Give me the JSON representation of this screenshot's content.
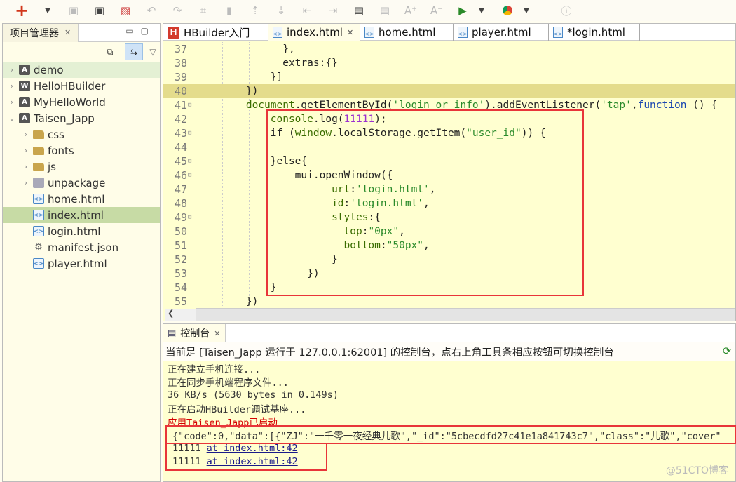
{
  "toolbar": {
    "icons": [
      "new-icon",
      "dropdown-icon",
      "save-icon",
      "save-all-icon",
      "close-file-icon",
      "undo-icon",
      "redo-icon",
      "format-icon",
      "bookmark-icon",
      "prev-edit-icon",
      "next-edit-icon",
      "indent-left-icon",
      "indent-right-icon",
      "comment-icon",
      "uncomment-icon",
      "font-increase-icon",
      "font-decrease-icon",
      "run-device-icon",
      "dropdown-icon",
      "chrome-icon",
      "dropdown-icon",
      "info-icon"
    ]
  },
  "sidebar": {
    "title": "项目管理器",
    "items": [
      {
        "label": "demo",
        "type": "proj",
        "mark": "A",
        "expanded": false,
        "depth": 0
      },
      {
        "label": "HelloHBuilder",
        "type": "proj",
        "mark": "W",
        "expanded": false,
        "depth": 0
      },
      {
        "label": "MyHelloWorld",
        "type": "proj",
        "mark": "A",
        "expanded": false,
        "depth": 0
      },
      {
        "label": "Taisen_Japp",
        "type": "proj",
        "mark": "A",
        "expanded": true,
        "depth": 0
      },
      {
        "label": "css",
        "type": "folder",
        "depth": 1
      },
      {
        "label": "fonts",
        "type": "folder",
        "depth": 1
      },
      {
        "label": "js",
        "type": "folder",
        "depth": 1
      },
      {
        "label": "unpackage",
        "type": "pkg",
        "depth": 1
      },
      {
        "label": "home.html",
        "type": "file",
        "depth": 1
      },
      {
        "label": "index.html",
        "type": "file",
        "depth": 1,
        "selected": true
      },
      {
        "label": "login.html",
        "type": "file",
        "depth": 1
      },
      {
        "label": "manifest.json",
        "type": "json",
        "depth": 1
      },
      {
        "label": "player.html",
        "type": "file",
        "depth": 1
      }
    ]
  },
  "editor": {
    "tabs": [
      {
        "label": "HBuilder入门",
        "icon": "hbuilder-icon"
      },
      {
        "label": "index.html",
        "icon": "html-file-icon",
        "active": true,
        "closable": true
      },
      {
        "label": "home.html",
        "icon": "html-file-icon"
      },
      {
        "label": "player.html",
        "icon": "html-file-icon"
      },
      {
        "label": "*login.html",
        "icon": "html-file-icon"
      }
    ],
    "lines": [
      {
        "n": "37",
        "t": [
          [
            "              },",
            "p"
          ]
        ]
      },
      {
        "n": "38",
        "t": [
          [
            "              extras:{}",
            "p"
          ]
        ]
      },
      {
        "n": "39",
        "t": [
          [
            "            }]",
            "p"
          ]
        ]
      },
      {
        "n": "40",
        "hl": true,
        "t": [
          [
            "        })",
            "p"
          ]
        ]
      },
      {
        "n": "41",
        "fold": true,
        "t": [
          [
            "        ",
            "p"
          ],
          [
            "document",
            "i"
          ],
          [
            ".getElementById(",
            "p"
          ],
          [
            "'login_or_info'",
            "s"
          ],
          [
            ").addEventListener(",
            "p"
          ],
          [
            "'tap'",
            "s"
          ],
          [
            ",",
            "p"
          ],
          [
            "function",
            "k"
          ],
          [
            " () {",
            "p"
          ]
        ]
      },
      {
        "n": "42",
        "t": [
          [
            "            ",
            "p"
          ],
          [
            "console",
            "i"
          ],
          [
            ".log(",
            "p"
          ],
          [
            "11111",
            "n"
          ],
          [
            ");",
            "p"
          ]
        ]
      },
      {
        "n": "43",
        "fold": true,
        "t": [
          [
            "            if (",
            "p"
          ],
          [
            "window",
            "i"
          ],
          [
            ".localStorage.getItem(",
            "p"
          ],
          [
            "\"user_id\"",
            "s"
          ],
          [
            ")) {",
            "p"
          ]
        ]
      },
      {
        "n": "44",
        "t": [
          [
            "",
            "p"
          ]
        ]
      },
      {
        "n": "45",
        "fold": true,
        "t": [
          [
            "            }else{",
            "p"
          ]
        ]
      },
      {
        "n": "46",
        "fold": true,
        "t": [
          [
            "                mui.openWindow({",
            "p"
          ]
        ]
      },
      {
        "n": "47",
        "t": [
          [
            "                      ",
            "p"
          ],
          [
            "url",
            "i"
          ],
          [
            ":",
            "p"
          ],
          [
            "'login.html'",
            "s"
          ],
          [
            ",",
            "p"
          ]
        ]
      },
      {
        "n": "48",
        "t": [
          [
            "                      ",
            "p"
          ],
          [
            "id",
            "i"
          ],
          [
            ":",
            "p"
          ],
          [
            "'login.html'",
            "s"
          ],
          [
            ",",
            "p"
          ]
        ]
      },
      {
        "n": "49",
        "fold": true,
        "t": [
          [
            "                      ",
            "p"
          ],
          [
            "styles",
            "i"
          ],
          [
            ":{",
            "p"
          ]
        ]
      },
      {
        "n": "50",
        "t": [
          [
            "                        ",
            "p"
          ],
          [
            "top",
            "i"
          ],
          [
            ":",
            "p"
          ],
          [
            "\"0px\"",
            "s"
          ],
          [
            ",",
            "p"
          ]
        ]
      },
      {
        "n": "51",
        "t": [
          [
            "                        ",
            "p"
          ],
          [
            "bottom",
            "i"
          ],
          [
            ":",
            "p"
          ],
          [
            "\"50px\"",
            "s"
          ],
          [
            ",",
            "p"
          ]
        ]
      },
      {
        "n": "52",
        "t": [
          [
            "                      }",
            "p"
          ]
        ]
      },
      {
        "n": "53",
        "t": [
          [
            "                  })",
            "p"
          ]
        ]
      },
      {
        "n": "54",
        "t": [
          [
            "            }",
            "p"
          ]
        ]
      },
      {
        "n": "55",
        "t": [
          [
            "        })",
            "p"
          ]
        ]
      }
    ]
  },
  "console": {
    "tab_label": "控制台",
    "info": "当前是 [Taisen_Japp 运行于 127.0.0.1:62001] 的控制台，点右上角工具条相应按钮可切换控制台",
    "lines": [
      {
        "text": "正在建立手机连接..."
      },
      {
        "text": "正在同步手机端程序文件..."
      },
      {
        "text": "36 KB/s (5630 bytes in 0.149s)"
      },
      {
        "text": "正在启动HBuilder调试基座..."
      },
      {
        "text": "应用Taisen_Japp已启动",
        "color": "red"
      },
      {
        "text": "{\"code\":0,\"data\":[{\"ZJ\":\"一千零一夜经典儿歌\",\"_id\":\"5cbecdfd27c41e1a841743c7\",\"class\":\"儿歌\",\"cover\""
      }
    ],
    "logs": [
      {
        "text": "11111",
        "link": "at index.html:42"
      },
      {
        "text": "11111",
        "link": "at index.html:42"
      }
    ]
  },
  "watermark": "@51CTO博客",
  "colors": {
    "highlight_box": "#e8353a",
    "selected_row": "#c7dba5",
    "editor_bg": "#ffffd0"
  }
}
